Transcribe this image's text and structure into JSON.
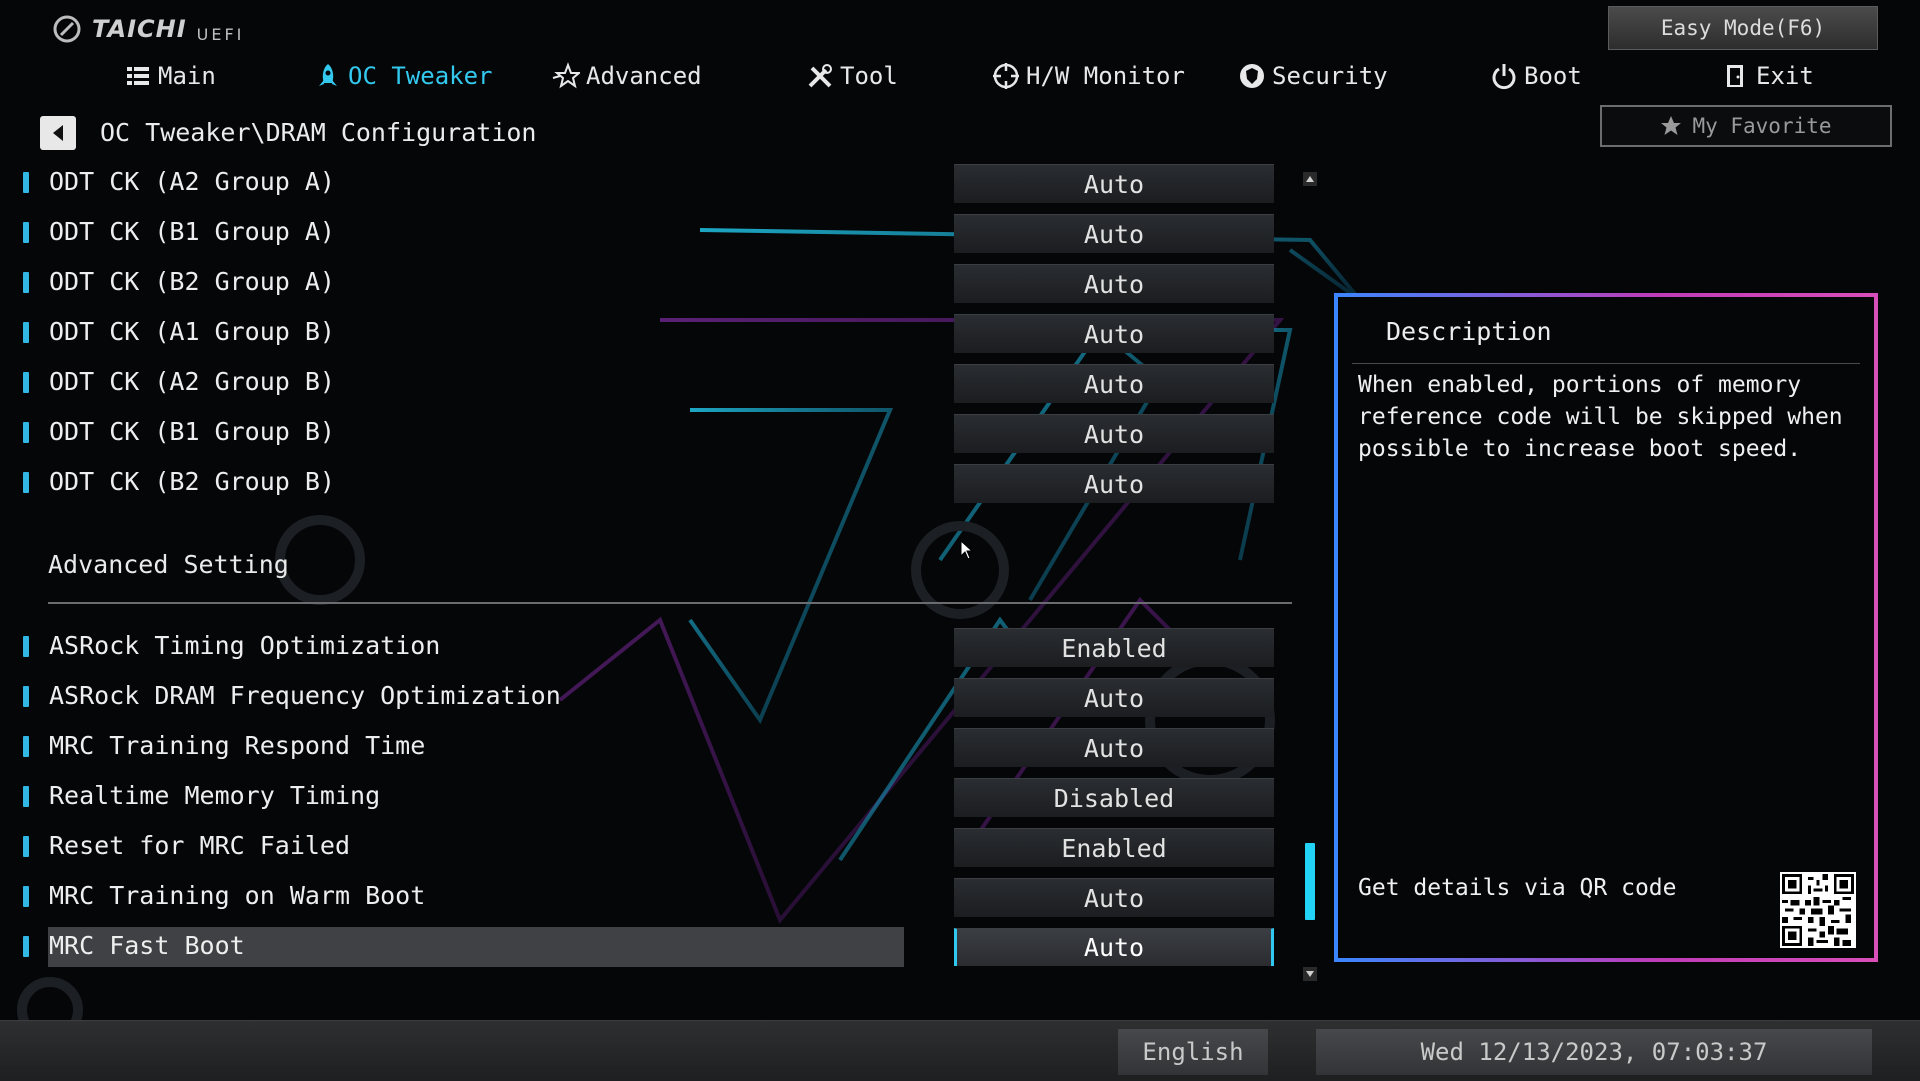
{
  "brand": {
    "name": "TAICHI",
    "sub": "UEFI"
  },
  "header": {
    "easy_mode": "Easy Mode(F6)",
    "my_favorite": "My Favorite"
  },
  "nav": [
    {
      "label": "Main",
      "icon": "list-icon"
    },
    {
      "label": "OC Tweaker",
      "icon": "rocket-icon",
      "active": true
    },
    {
      "label": "Advanced",
      "icon": "star-icon"
    },
    {
      "label": "Tool",
      "icon": "tools-icon"
    },
    {
      "label": "H/W Monitor",
      "icon": "crosshair-icon"
    },
    {
      "label": "Security",
      "icon": "shield-icon"
    },
    {
      "label": "Boot",
      "icon": "power-icon"
    },
    {
      "label": "Exit",
      "icon": "exit-door-icon"
    }
  ],
  "breadcrumb": "OC Tweaker\\DRAM Configuration",
  "settings_top": [
    {
      "label": "ODT CK (A2 Group A)",
      "value": "Auto"
    },
    {
      "label": "ODT CK (B1 Group A)",
      "value": "Auto"
    },
    {
      "label": "ODT CK (B2 Group A)",
      "value": "Auto"
    },
    {
      "label": "ODT CK (A1 Group B)",
      "value": "Auto"
    },
    {
      "label": "ODT CK (A2 Group B)",
      "value": "Auto"
    },
    {
      "label": "ODT CK (B1 Group B)",
      "value": "Auto"
    },
    {
      "label": "ODT CK (B2 Group B)",
      "value": "Auto"
    }
  ],
  "section_title": "Advanced Setting",
  "settings_advanced": [
    {
      "label": "ASRock Timing Optimization",
      "value": "Enabled"
    },
    {
      "label": "ASRock DRAM Frequency Optimization",
      "value": "Auto"
    },
    {
      "label": "MRC Training Respond Time",
      "value": "Auto"
    },
    {
      "label": "Realtime Memory Timing",
      "value": "Disabled"
    },
    {
      "label": "Reset for MRC Failed",
      "value": "Enabled"
    },
    {
      "label": "MRC Training on Warm Boot",
      "value": "Auto"
    },
    {
      "label": "MRC Fast Boot",
      "value": "Auto",
      "selected": true
    }
  ],
  "scrollbar": {
    "position": 0.94,
    "visible_fraction": 0.1
  },
  "description": {
    "title": "Description",
    "text": "When enabled, portions of memory reference code will be skipped when possible to increase boot speed.",
    "qr_label": "Get details via QR code"
  },
  "footer": {
    "language": "English",
    "datetime": "Wed 12/13/2023, 07:03:37"
  },
  "colors": {
    "accent": "#33c9ef",
    "panel_border_start": "#3a86ff",
    "panel_border_end": "#d84fb9"
  }
}
